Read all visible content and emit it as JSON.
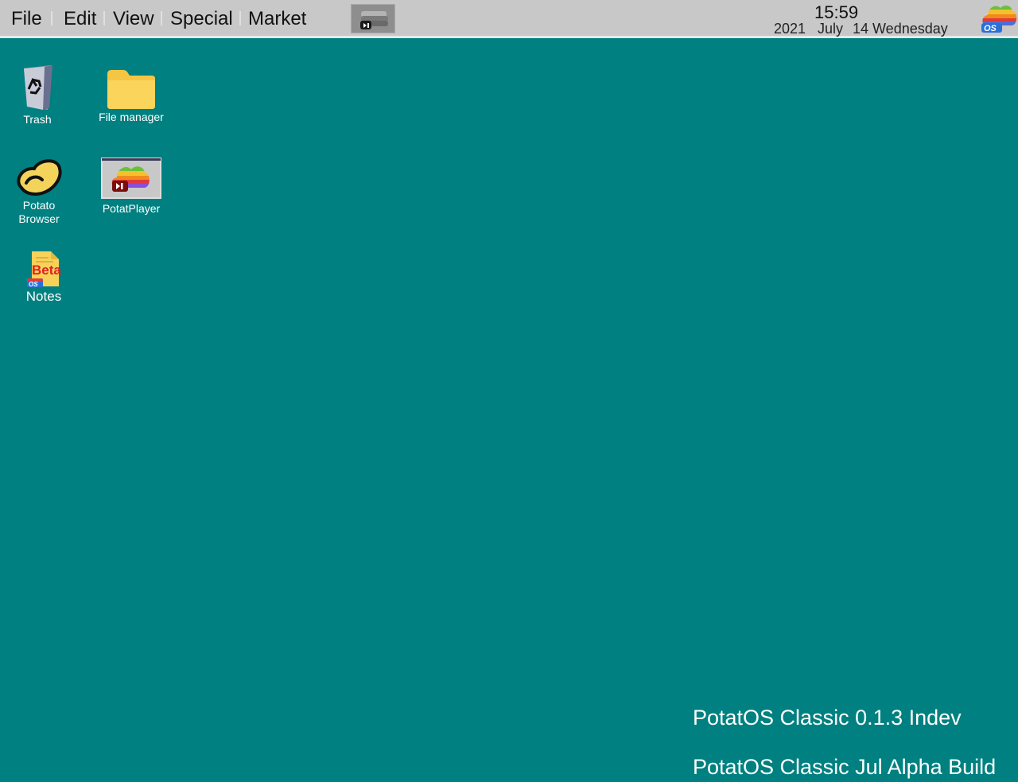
{
  "menubar": {
    "menus": [
      "File",
      "Edit",
      "View",
      "Special",
      "Market"
    ],
    "tray_icon": "potatplayer-tray-icon",
    "clock": {
      "time": "15:59",
      "year": "2021",
      "month": "July",
      "day": "14 Wednesday"
    },
    "logo": "potatos-logo-icon"
  },
  "desktop": {
    "icons": [
      {
        "label": "Trash",
        "icon": "trash-icon"
      },
      {
        "label": "File manager",
        "icon": "folder-icon"
      },
      {
        "label": "Potato Browser",
        "icon": "potato-browser-icon"
      },
      {
        "label": "PotatPlayer",
        "icon": "potatplayer-icon"
      },
      {
        "label": "Notes",
        "icon": "notes-icon",
        "badge": "Beta"
      }
    ],
    "background_color": "#008080"
  },
  "watermark": {
    "line1": "PotatOS Classic 0.1.3 Indev",
    "line2": "PotatOS Classic Jul Alpha Build"
  },
  "colors": {
    "menubar": "#c8c8c8",
    "desktop": "#008080",
    "text_on_desktop": "#ffffff"
  }
}
